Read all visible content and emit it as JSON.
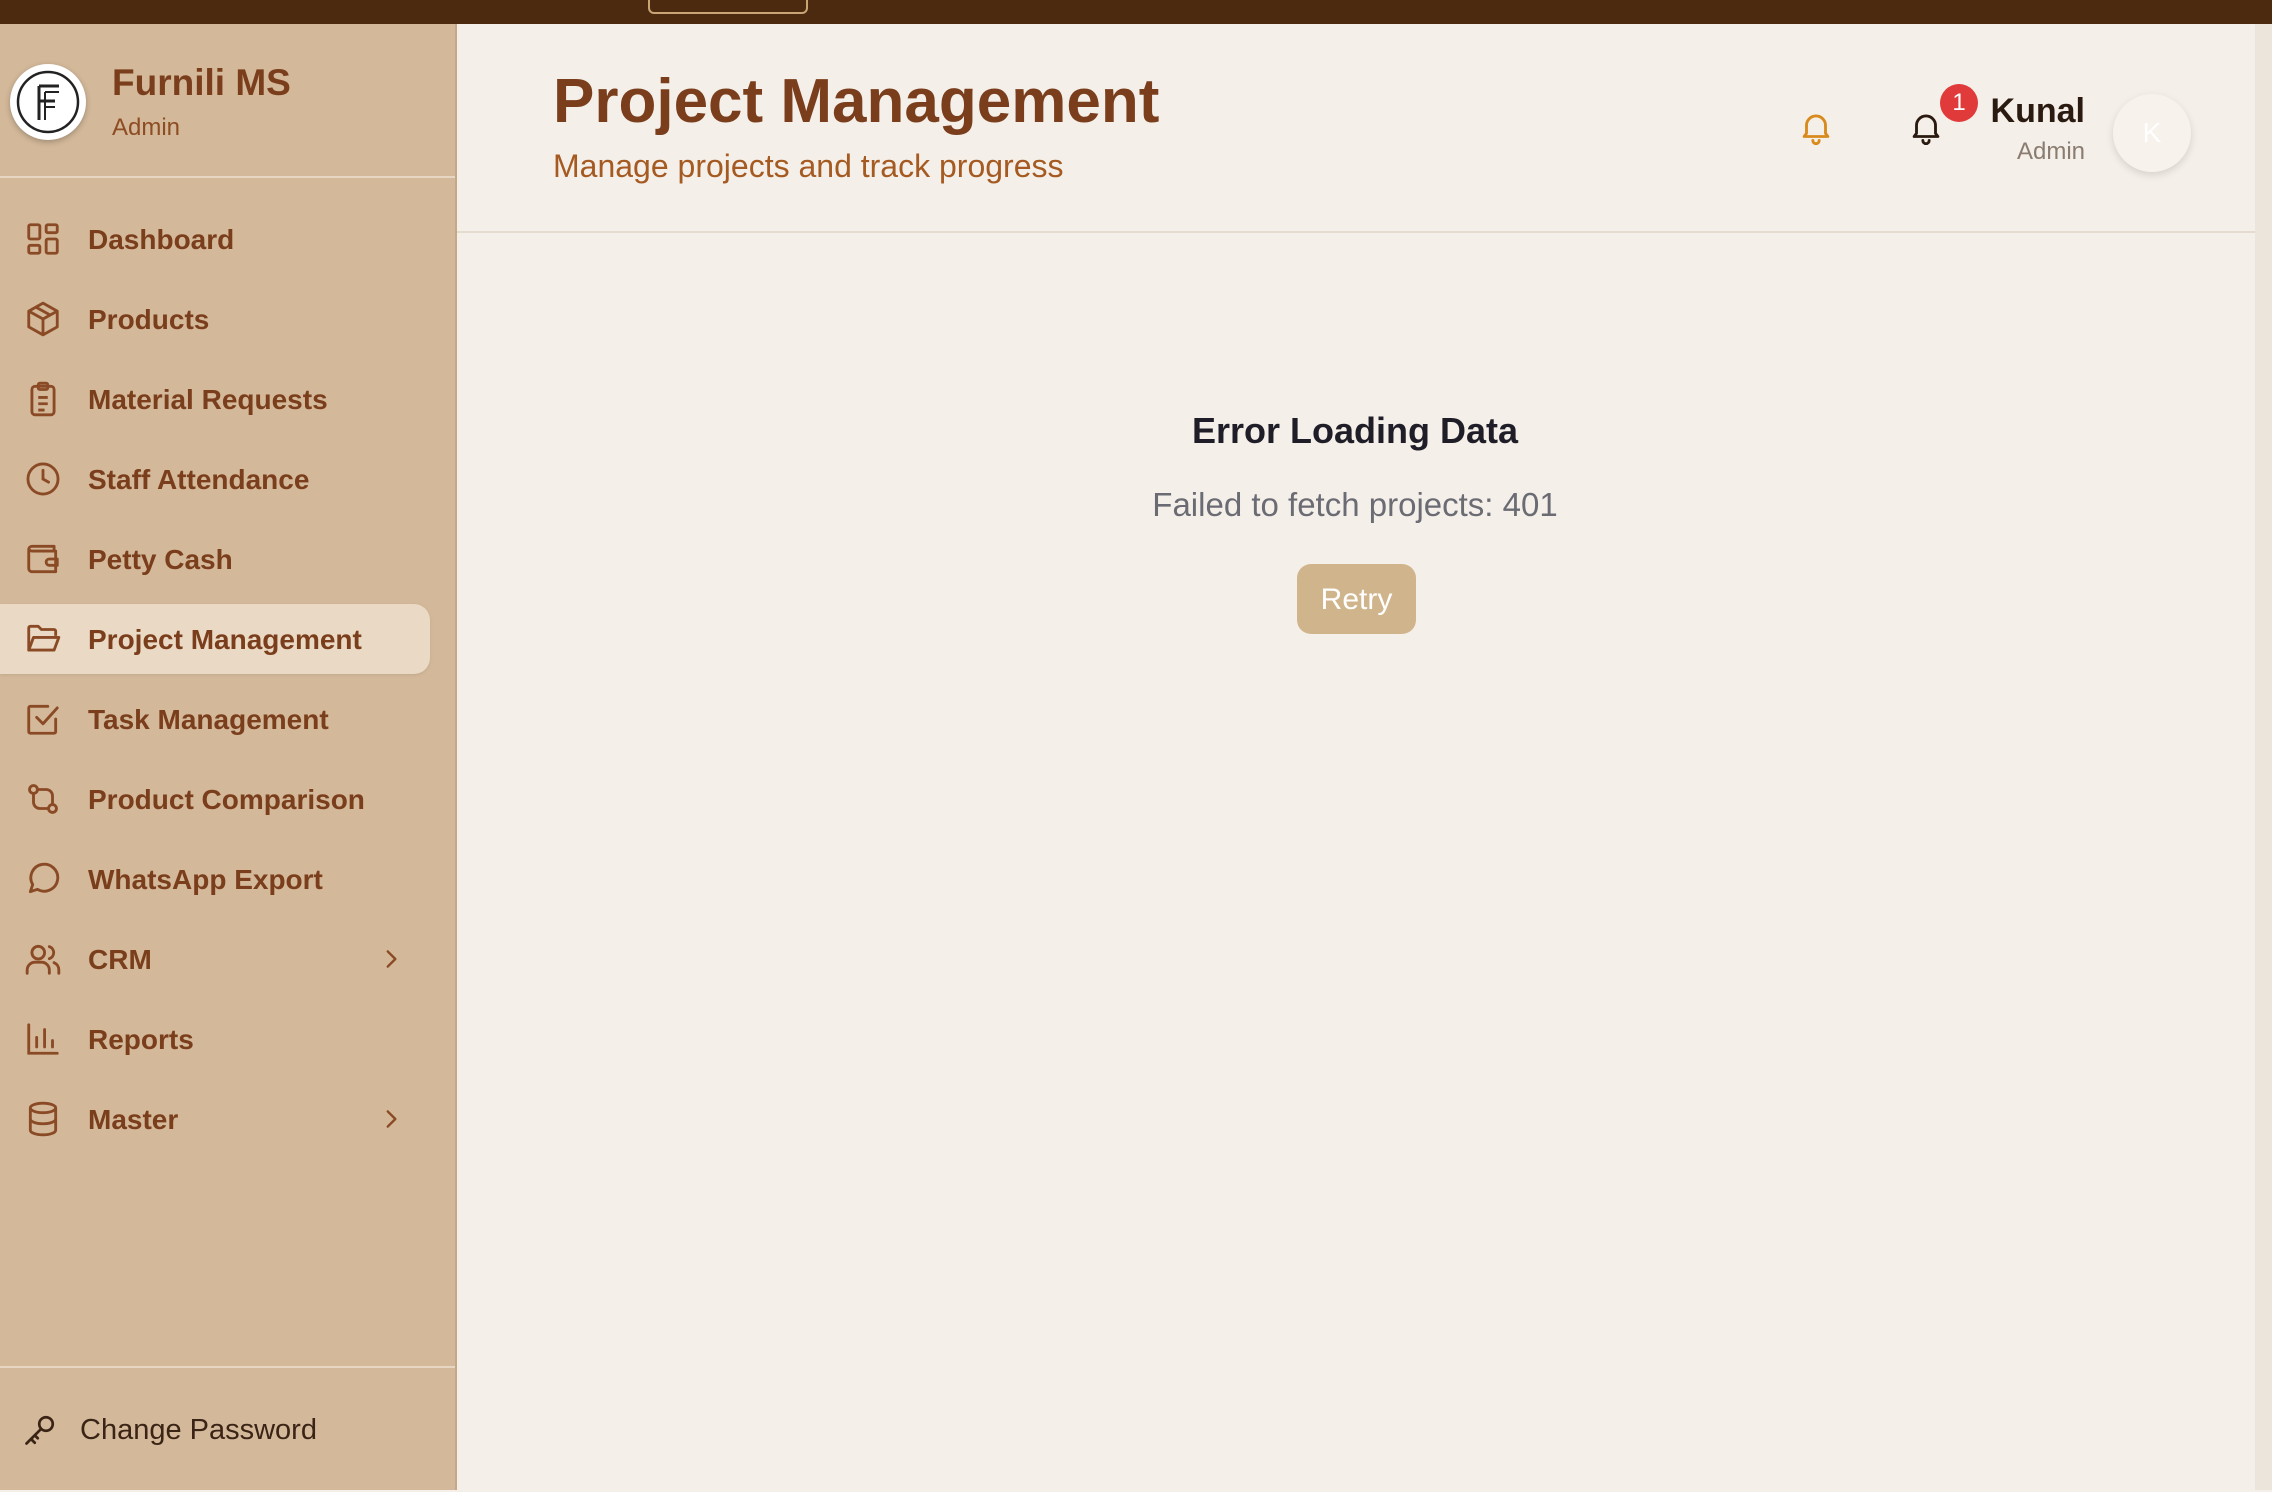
{
  "brand": {
    "title": "Furnili MS",
    "role": "Admin",
    "logo_icon": "furnili-logo-icon"
  },
  "sidebar": {
    "items": [
      {
        "label": "Dashboard",
        "icon": "dashboard-grid-icon"
      },
      {
        "label": "Products",
        "icon": "package-box-icon"
      },
      {
        "label": "Material Requests",
        "icon": "clipboard-list-icon"
      },
      {
        "label": "Staff Attendance",
        "icon": "clock-icon"
      },
      {
        "label": "Petty Cash",
        "icon": "wallet-icon"
      },
      {
        "label": "Project Management",
        "icon": "folder-open-icon",
        "active": true
      },
      {
        "label": "Task Management",
        "icon": "checkbox-icon"
      },
      {
        "label": "Product Comparison",
        "icon": "git-compare-icon"
      },
      {
        "label": "WhatsApp Export",
        "icon": "message-circle-icon"
      },
      {
        "label": "CRM",
        "icon": "users-icon",
        "expandable": true
      },
      {
        "label": "Reports",
        "icon": "bar-chart-icon"
      },
      {
        "label": "Master",
        "icon": "database-icon",
        "expandable": true
      }
    ],
    "change_password": "Change Password"
  },
  "header": {
    "title": "Project Management",
    "subtitle": "Manage projects and track progress",
    "notification_count": "1",
    "user_name": "Kunal",
    "user_role": "Admin",
    "avatar_initial": "K"
  },
  "error": {
    "title": "Error Loading Data",
    "message": "Failed to fetch projects: 401",
    "retry_label": "Retry"
  },
  "colors": {
    "topbar": "#4b2a10",
    "sidebar": "#d3b899",
    "active_item": "#ead9c4",
    "brand_text": "#7a3e1c",
    "content_bg": "#f4efe8",
    "retry_button": "#d0b58c",
    "badge": "#e03a3a"
  }
}
